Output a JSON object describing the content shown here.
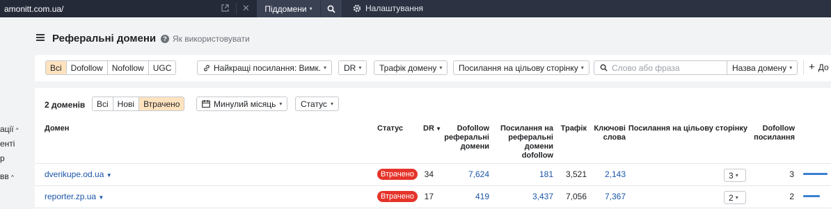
{
  "topbar": {
    "url": "amonitt.com.ua/",
    "subdomain_label": "Піддомени",
    "settings_label": "Налаштування"
  },
  "sidebar": {
    "frag1": "ації",
    "frag2": "енті",
    "frag3": "р",
    "frag4": "вв"
  },
  "page": {
    "title": "Реферальні домени",
    "help_label": "Як використовувати"
  },
  "filters": {
    "link_types": [
      "Всі",
      "Dofollow",
      "Nofollow",
      "UGC"
    ],
    "best_links": "Найкращі посилання: Вимк.",
    "dr": "DR",
    "traffic": "Трафік домену",
    "target_links": "Посилання на цільову сторінку",
    "search_placeholder": "Слово або фраза",
    "name_select": "Назва домену",
    "add_label": "До"
  },
  "table_controls": {
    "count": "2 доменів",
    "tabs": [
      "Всі",
      "Нові",
      "Втрачено"
    ],
    "period": "Минулий місяць",
    "status": "Статус"
  },
  "columns": {
    "domain": "Домен",
    "status": "Статус",
    "dr": "DR",
    "dofollow_ref": [
      "Dofollow",
      "реферальні",
      "домени"
    ],
    "links_to_ref": [
      "Посилання на",
      "реферальні",
      "домени",
      "dofollow"
    ],
    "traffic": "Трафік",
    "keywords": [
      "Ключові",
      "слова"
    ],
    "target_links": "Посилання на цільову сторінку",
    "dofollow_links": [
      "Dofollow",
      "посилання"
    ]
  },
  "rows": [
    {
      "domain": "dverikupe.od.ua",
      "status": "Втрачено",
      "dr": "34",
      "dofollow_ref": "7,624",
      "links": "181",
      "traffic": "3,521",
      "keywords": "2,143",
      "target": "3",
      "dofollow_links": "3"
    },
    {
      "domain": "reporter.zp.ua",
      "status": "Втрачено",
      "dr": "17",
      "dofollow_ref": "419",
      "links": "3,437",
      "traffic": "7,056",
      "keywords": "7,367",
      "target": "2",
      "dofollow_links": "2"
    }
  ],
  "colors": {
    "accent_active": "#ffe3bf",
    "lost_badge": "#e5342a",
    "link": "#1a55a7",
    "topbar": "#2c3242"
  }
}
